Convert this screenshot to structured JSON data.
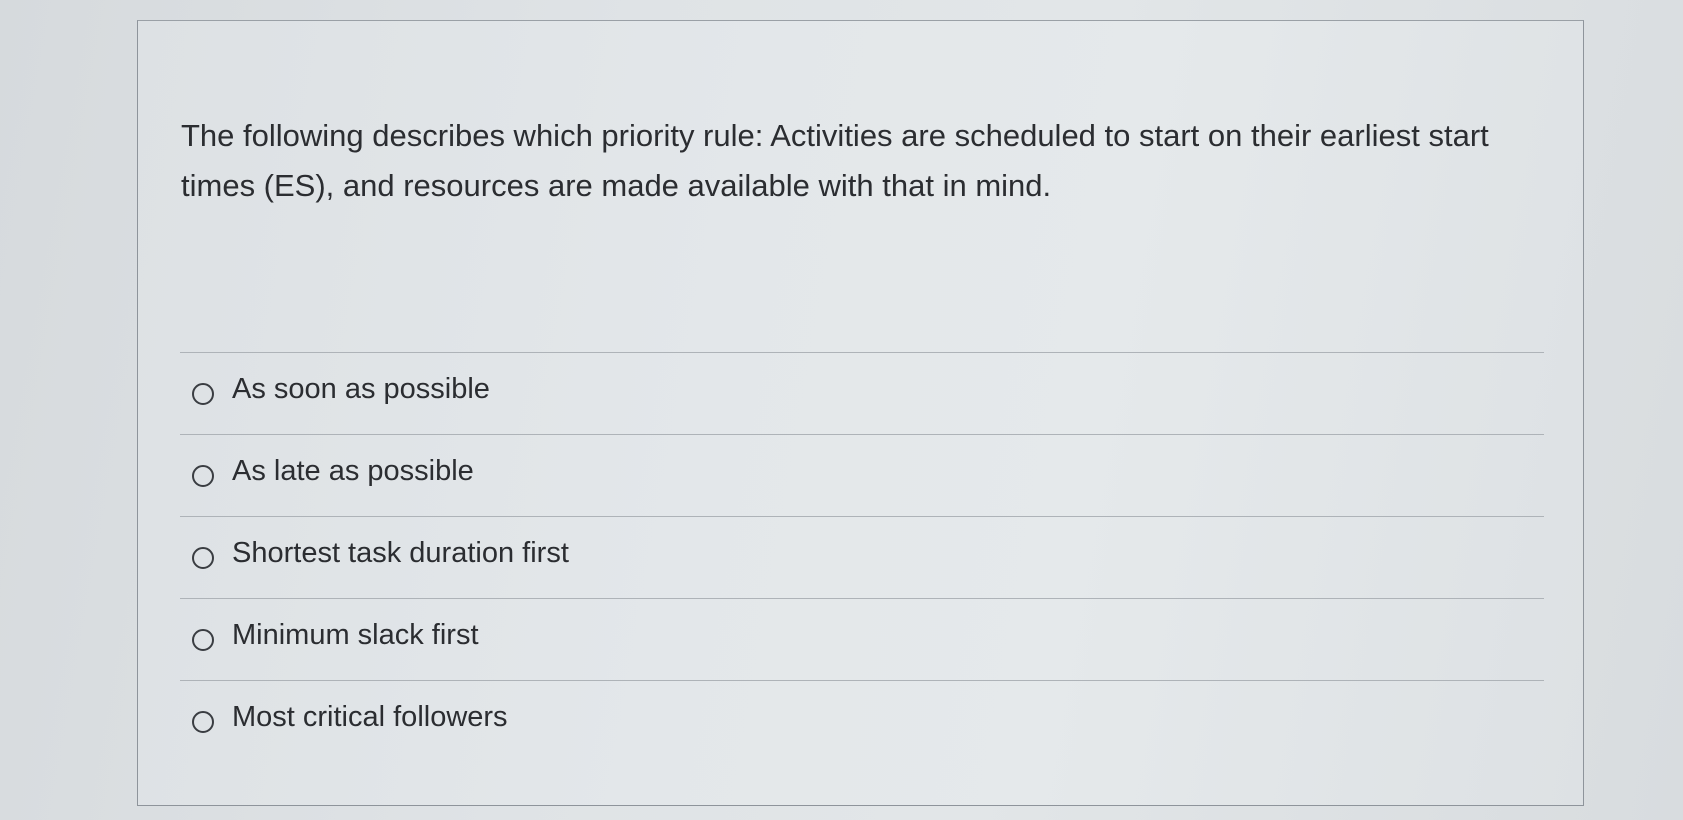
{
  "question": {
    "text": "The following describes which priority rule: Activities are scheduled to start on their earliest start times (ES), and resources are made available with that in mind."
  },
  "options": [
    {
      "label": "As soon as possible",
      "selected": false
    },
    {
      "label": "As late as possible",
      "selected": false
    },
    {
      "label": "Shortest task duration first",
      "selected": false
    },
    {
      "label": "Minimum slack first",
      "selected": false
    },
    {
      "label": "Most critical followers",
      "selected": false
    }
  ]
}
